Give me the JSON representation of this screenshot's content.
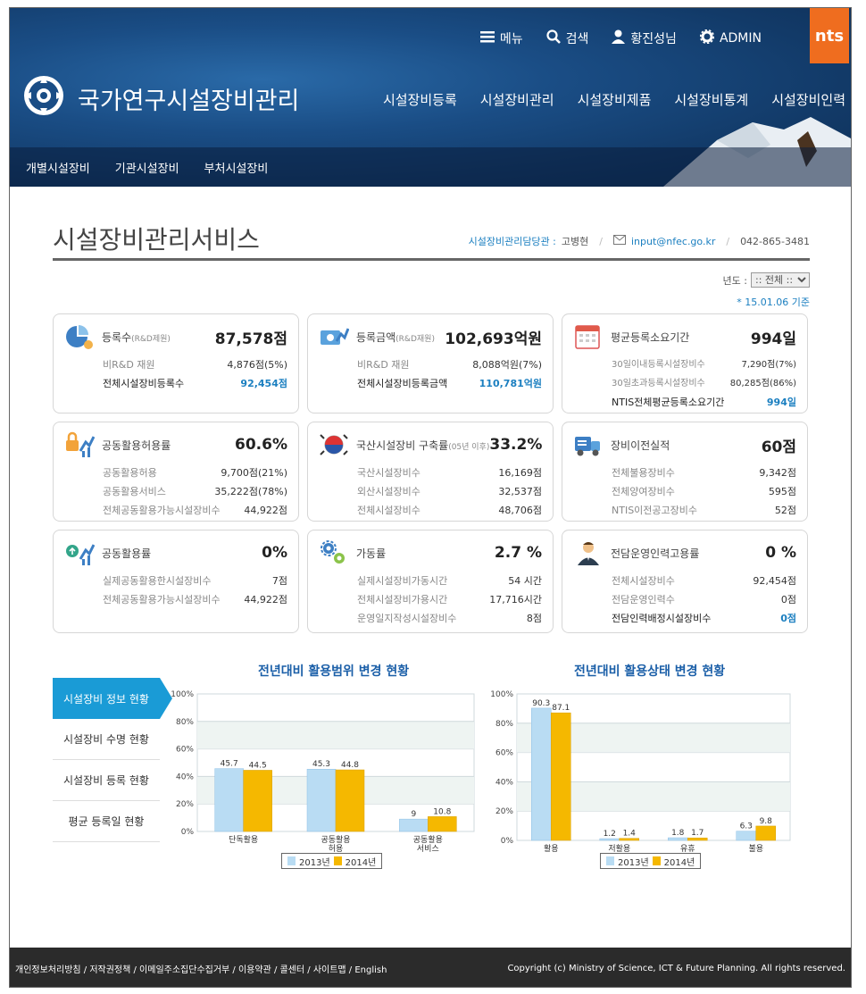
{
  "header": {
    "util": {
      "menu": "메뉴",
      "search": "검색",
      "user": "황진성님",
      "admin": "ADMIN"
    },
    "ntis_logo": "nts",
    "site_title": "국가연구시설장비관리",
    "gnb": [
      "시설장비등록",
      "시설장비관리",
      "시설장비제품",
      "시설장비통계",
      "시설장비인력"
    ],
    "subnav": [
      "개별시설장비",
      "기관시설장비",
      "부처시설장비"
    ]
  },
  "page": {
    "title": "시설장비관리서비스",
    "contact_label": "시설장비관리담당관 :",
    "contact_name": "고병현",
    "contact_email": "input@nfec.go.kr",
    "contact_phone": "042-865-3481",
    "year_label": "년도 :",
    "year_value": ":: 전체 ::",
    "basis": "* 15.01.06 기준"
  },
  "cards": [
    {
      "title": "등록수",
      "sub": "(R&D제원)",
      "big": "87,578점",
      "rows": [
        {
          "k": "비R&D 재원",
          "v": "4,876점(5%)",
          "em": false
        },
        {
          "k": "전체시설장비등록수",
          "v": "92,454점",
          "em": true
        }
      ]
    },
    {
      "title": "등록금액",
      "sub": "(R&D재원)",
      "big": "102,693억원",
      "rows": [
        {
          "k": "비R&D 재원",
          "v": "8,088억원(7%)",
          "em": false
        },
        {
          "k": "전체시설장비등록금액",
          "v": "110,781억원",
          "em": true
        }
      ]
    },
    {
      "title": "평균등록소요기간",
      "sub": "",
      "big": "994일",
      "rows": [
        {
          "k": "30일이내등록시설장비수",
          "v": "7,290점(7%)",
          "em": false
        },
        {
          "k": "30일초과등록시설장비수",
          "v": "80,285점(86%)",
          "em": false
        },
        {
          "k": "NTIS전체평균등록소요기간",
          "v": "994일",
          "em": true
        }
      ]
    },
    {
      "title": "공동활용허용률",
      "sub": "",
      "big": "60.6%",
      "rows": [
        {
          "k": "공동활용허용",
          "v": "9,700점(21%)",
          "em": false
        },
        {
          "k": "공동활용서비스",
          "v": "35,222점(78%)",
          "em": false
        },
        {
          "k": "전체공동활용가능시설장비수",
          "v": "44,922점",
          "em": false
        }
      ]
    },
    {
      "title": "국산시설장비 구축률",
      "sub": "(05년 이후)",
      "big": "33.2%",
      "rows": [
        {
          "k": "국산시설장비수",
          "v": "16,169점",
          "em": false
        },
        {
          "k": "외산시설장비수",
          "v": "32,537점",
          "em": false
        },
        {
          "k": "전체시설장비수",
          "v": "48,706점",
          "em": false
        }
      ]
    },
    {
      "title": "장비이전실적",
      "sub": "",
      "big": "60점",
      "rows": [
        {
          "k": "전체불용장비수",
          "v": "9,342점",
          "em": false
        },
        {
          "k": "전체양여장비수",
          "v": "595점",
          "em": false
        },
        {
          "k": "NTIS이전공고장비수",
          "v": "52점",
          "em": false
        }
      ]
    },
    {
      "title": "공동활용률",
      "sub": "",
      "big": "0%",
      "rows": [
        {
          "k": "실제공동활용한시설장비수",
          "v": "7점",
          "em": false
        },
        {
          "k": "전체공동활용가능시설장비수",
          "v": "44,922점",
          "em": false
        }
      ]
    },
    {
      "title": "가동률",
      "sub": "",
      "big": "2.7 %",
      "rows": [
        {
          "k": "실제시설장비가동시간",
          "v": "54 시간",
          "em": false
        },
        {
          "k": "전체시설장비가용시간",
          "v": "17,716시간",
          "em": false
        },
        {
          "k": "운영일지작성시설장비수",
          "v": "8점",
          "em": false
        }
      ]
    },
    {
      "title": "전담운영인력고용률",
      "sub": "",
      "big": "0 %",
      "rows": [
        {
          "k": "전체시설장비수",
          "v": "92,454점",
          "em": false
        },
        {
          "k": "전담운영인력수",
          "v": "0점",
          "em": false
        },
        {
          "k": "전담인력배정시설장비수",
          "v": "0점",
          "em": true
        }
      ]
    }
  ],
  "tabs": [
    "시설장비 정보 현황",
    "시설장비 수명 현황",
    "시설장비 등록 현황",
    "평균 등록일 현황"
  ],
  "legend": {
    "s2013": "2013년",
    "s2014": "2014년"
  },
  "colors": {
    "s2013": "#b9dcf3",
    "s2014": "#f5b800",
    "accent": "#1a9bd6",
    "ntis": "#ef6d1f"
  },
  "chart_data": [
    {
      "type": "bar",
      "title": "전년대비 활용범위 변경 현황",
      "categories": [
        "단독활용",
        "공동활용\n허용",
        "공동활용\n서비스"
      ],
      "series": [
        {
          "name": "2013년",
          "values": [
            45.7,
            45.3,
            9
          ]
        },
        {
          "name": "2014년",
          "values": [
            44.5,
            44.8,
            10.8
          ]
        }
      ],
      "yticks": [
        "0%",
        "20%",
        "40%",
        "60%",
        "80%",
        "100%"
      ],
      "ylim": [
        0,
        100
      ],
      "legend": "bottom"
    },
    {
      "type": "bar",
      "title": "전년대비 활용상태 변경 현황",
      "categories": [
        "활용",
        "저활용",
        "유휴",
        "불용"
      ],
      "series": [
        {
          "name": "2013년",
          "values": [
            90.3,
            1.2,
            1.8,
            6.3
          ]
        },
        {
          "name": "2014년",
          "values": [
            87.1,
            1.4,
            1.7,
            9.8
          ]
        }
      ],
      "yticks": [
        "0%",
        "20%",
        "40%",
        "60%",
        "80%",
        "100%"
      ],
      "ylim": [
        0,
        100
      ],
      "legend": "bottom"
    }
  ],
  "footer": {
    "links": "개인정보처리방침 / 저작권정책 / 이메일주소집단수집거부 / 이용약관 / 콜센터 / 사이트맵 / English",
    "copyright": "Copyright (c) Ministry of Science, ICT & Future Planning. All rights reserved."
  }
}
